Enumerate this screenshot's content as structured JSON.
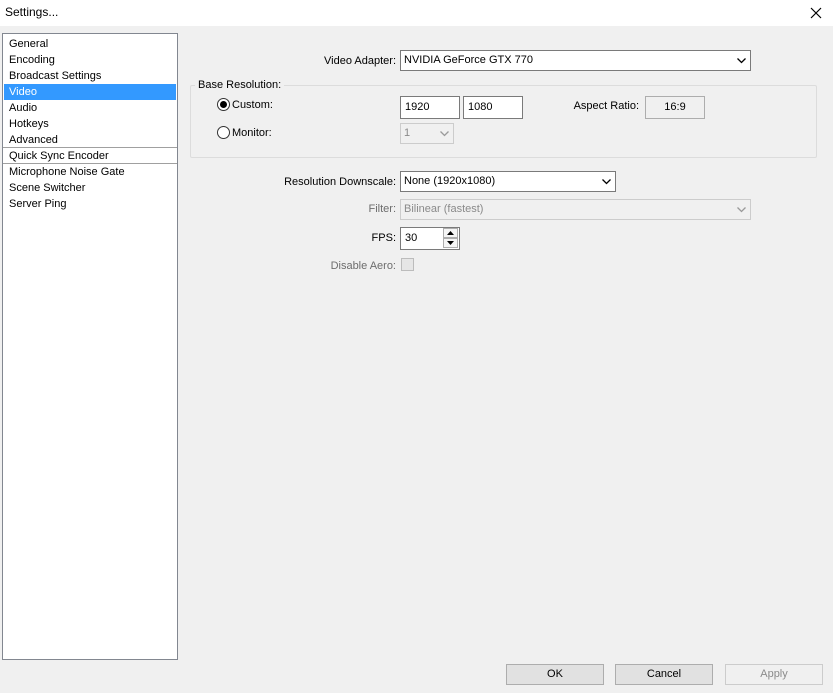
{
  "window": {
    "title": "Settings..."
  },
  "sidebar": {
    "items": [
      "General",
      "Encoding",
      "Broadcast Settings",
      "Video",
      "Audio",
      "Hotkeys",
      "Advanced",
      "Quick Sync Encoder",
      "Microphone Noise Gate",
      "Scene Switcher",
      "Server Ping"
    ],
    "selected": "Video"
  },
  "video": {
    "adapter_label": "Video Adapter:",
    "adapter_value": "NVIDIA GeForce GTX 770",
    "base_resolution_label": "Base Resolution:",
    "custom_label": "Custom:",
    "custom_checked": true,
    "width": "1920",
    "height": "1080",
    "aspect_ratio_label": "Aspect Ratio:",
    "aspect_ratio_value": "16:9",
    "monitor_label": "Monitor:",
    "monitor_value": "1",
    "downscale_label": "Resolution Downscale:",
    "downscale_value": "None  (1920x1080)",
    "filter_label": "Filter:",
    "filter_value": "Bilinear (fastest)",
    "fps_label": "FPS:",
    "fps_value": "30",
    "disable_aero_label": "Disable Aero:"
  },
  "buttons": {
    "ok": "OK",
    "cancel": "Cancel",
    "apply": "Apply"
  },
  "colors": {
    "selection": "#3399ff",
    "background": "#f0f0f0"
  }
}
